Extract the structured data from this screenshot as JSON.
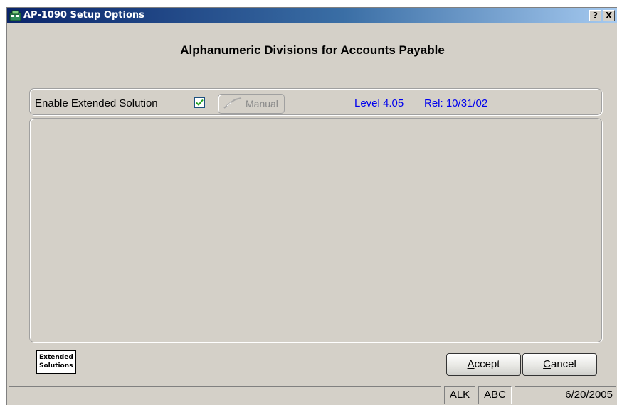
{
  "window": {
    "title": "AP-1090 Setup Options",
    "help_button": "?",
    "close_button": "X"
  },
  "heading": "Alphanumeric Divisions for Accounts Payable",
  "options": {
    "enable_label": "Enable Extended Solution",
    "enable_checked": true,
    "manual_label": "Manual",
    "level": "Level 4.05",
    "release": "Rel: 10/31/02"
  },
  "logo": {
    "line1": "Extended",
    "line2": "Solutions"
  },
  "buttons": {
    "accept": {
      "accel": "A",
      "rest": "ccept"
    },
    "cancel": {
      "accel": "C",
      "rest": "ancel"
    }
  },
  "statusbar": {
    "message": "",
    "user": "ALK",
    "company": "ABC",
    "date": "6/20/2005"
  },
  "colors": {
    "title_start": "#0a246a",
    "title_end": "#a6caf0",
    "link_blue": "#0000ee",
    "face": "#d4d0c8"
  }
}
